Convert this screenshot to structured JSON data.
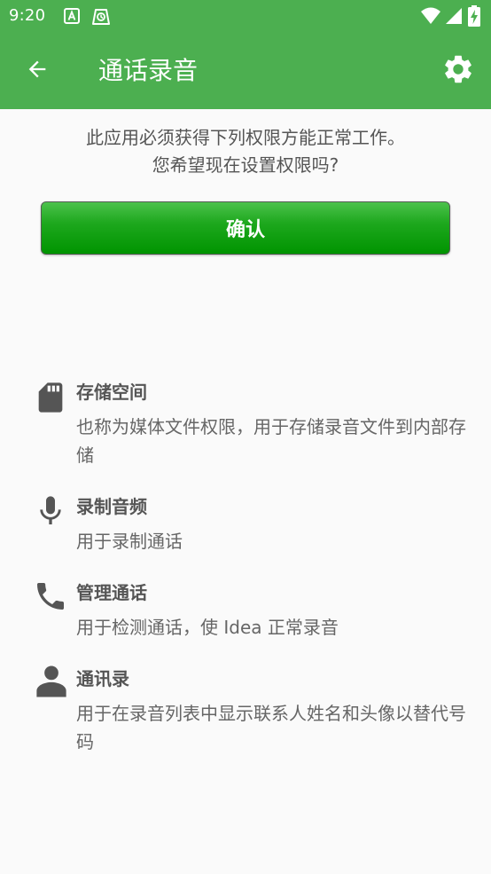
{
  "status_bar": {
    "time": "9:20",
    "icons": [
      "a-notification-icon",
      "cleaner-notification-icon",
      "wifi-icon",
      "signal-icon",
      "battery-charging-icon"
    ]
  },
  "app_bar": {
    "back_icon": "arrow-left-icon",
    "title": "通话录音",
    "settings_icon": "gear-icon"
  },
  "message": {
    "line1": "此应用必须获得下列权限方能正常工作。",
    "line2": "您希望现在设置权限吗?"
  },
  "confirm_button": {
    "label": "确认"
  },
  "permissions": [
    {
      "icon": "sd-card-icon",
      "title": "存储空间",
      "description": "也称为媒体文件权限，用于存储录音文件到内部存储"
    },
    {
      "icon": "microphone-icon",
      "title": "录制音频",
      "description": "用于录制通话"
    },
    {
      "icon": "phone-icon",
      "title": "管理通话",
      "description": "用于检测通话，使 Idea 正常录音"
    },
    {
      "icon": "person-icon",
      "title": "通讯录",
      "description": "用于在录音列表中显示联系人姓名和头像以替代号码"
    }
  ],
  "colors": {
    "primary": "#4caf50",
    "button_green": "#009400",
    "background": "#fafafa",
    "text_gray": "#555555",
    "icon_gray": "#555555"
  }
}
